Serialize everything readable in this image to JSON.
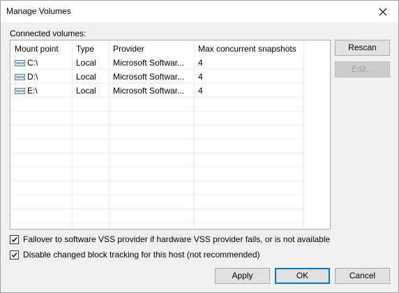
{
  "window": {
    "title": "Manage Volumes"
  },
  "volumes_section": {
    "label": "Connected volumes:"
  },
  "table": {
    "headers": [
      "Mount point",
      "Type",
      "Provider",
      "Max concurrent snapshots"
    ],
    "rows": [
      {
        "mount": "C:\\",
        "type": "Local",
        "provider": "Microsoft Softwar...",
        "max": "4"
      },
      {
        "mount": "D:\\",
        "type": "Local",
        "provider": "Microsoft Softwar...",
        "max": "4"
      },
      {
        "mount": "E:\\",
        "type": "Local",
        "provider": "Microsoft Softwar...",
        "max": "4"
      }
    ],
    "row_icon": "drive-icon"
  },
  "side_buttons": {
    "rescan": "Rescan",
    "edit": "Edit..."
  },
  "options": {
    "failover": {
      "label": "Failover to software VSS provider if hardware VSS provider fails, or is not available",
      "checked": true
    },
    "cbt": {
      "label": "Disable changed block tracking for this host (not recommended)",
      "checked": true
    }
  },
  "footer_buttons": {
    "apply": "Apply",
    "ok": "OK",
    "cancel": "Cancel"
  },
  "colors": {
    "accent": "#0078d7",
    "window_bg": "#f0f0f0",
    "list_bg": "#ffffff"
  }
}
